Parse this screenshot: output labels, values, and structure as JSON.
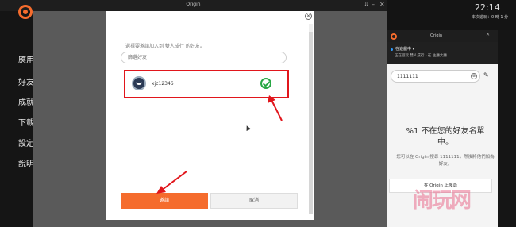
{
  "main_window": {
    "title": "Origin",
    "controls": [
      "⇓",
      "–",
      "✕"
    ]
  },
  "sidebar": {
    "items": [
      {
        "label": "應用"
      },
      {
        "label": "好友"
      },
      {
        "label": "成就"
      },
      {
        "label": "下載"
      },
      {
        "label": "設定"
      },
      {
        "label": "說明"
      }
    ]
  },
  "dialog": {
    "close": "✕",
    "prompt": "選擇要邀請加入到 雙人成行 的好友。",
    "search_placeholder": "篩選好友",
    "friends": [
      {
        "name": "xjc12346",
        "selected": true
      }
    ],
    "invite_label": "邀請",
    "cancel_label": "取消"
  },
  "system": {
    "time": "22:14",
    "session": "本次遊玩：0 時 1 分",
    "controls": [
      "⇓",
      "✕"
    ]
  },
  "friends_panel": {
    "title": "Origin",
    "controls": [
      "–",
      "✕"
    ],
    "status": "在遊戲中 ▾",
    "activity": "正在遊玩 雙人成行 - 在 主廳大廳",
    "search_value": "1111111",
    "clear": "⊗",
    "not_friend_title": "%1 不在您的好友名單中。",
    "not_friend_desc": "您可以在 Origin 搜尋 1111111，然後將他們加為好友。",
    "search_origin_button": "在 Origin 上搜尋",
    "watermark": "闹玩网"
  },
  "colors": {
    "accent": "#f56c2d",
    "highlight": "#e1161c",
    "check": "#28a745"
  }
}
